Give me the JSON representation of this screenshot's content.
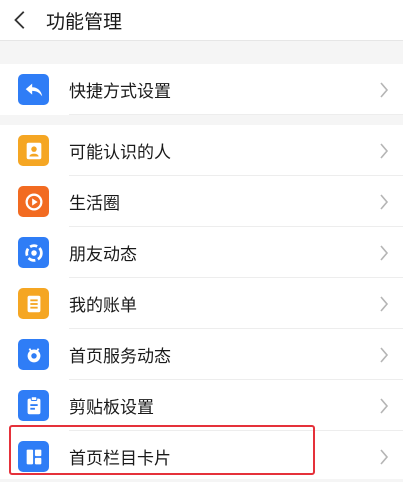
{
  "header": {
    "title": "功能管理"
  },
  "sections": [
    [
      {
        "id": "shortcut",
        "label": "快捷方式设置",
        "icon": "reply-arrow-icon",
        "color": "#2f7df6"
      }
    ],
    [
      {
        "id": "people-you-may-know",
        "label": "可能认识的人",
        "icon": "contact-card-icon",
        "color": "#f5a623"
      },
      {
        "id": "life-circle",
        "label": "生活圈",
        "icon": "play-circle-icon",
        "color": "#f26b21"
      },
      {
        "id": "friends-activity",
        "label": "朋友动态",
        "icon": "aperture-icon",
        "color": "#2f7df6"
      },
      {
        "id": "my-bill",
        "label": "我的账单",
        "icon": "bill-icon",
        "color": "#f5a623"
      },
      {
        "id": "home-service-activity",
        "label": "首页服务动态",
        "icon": "bell-mascot-icon",
        "color": "#2f7df6"
      },
      {
        "id": "clipboard-settings",
        "label": "剪贴板设置",
        "icon": "clipboard-icon",
        "color": "#2f7df6"
      },
      {
        "id": "home-column-card",
        "label": "首页栏目卡片",
        "icon": "grid-card-icon",
        "color": "#2f7df6"
      }
    ]
  ],
  "highlight_color": "#e5313a"
}
